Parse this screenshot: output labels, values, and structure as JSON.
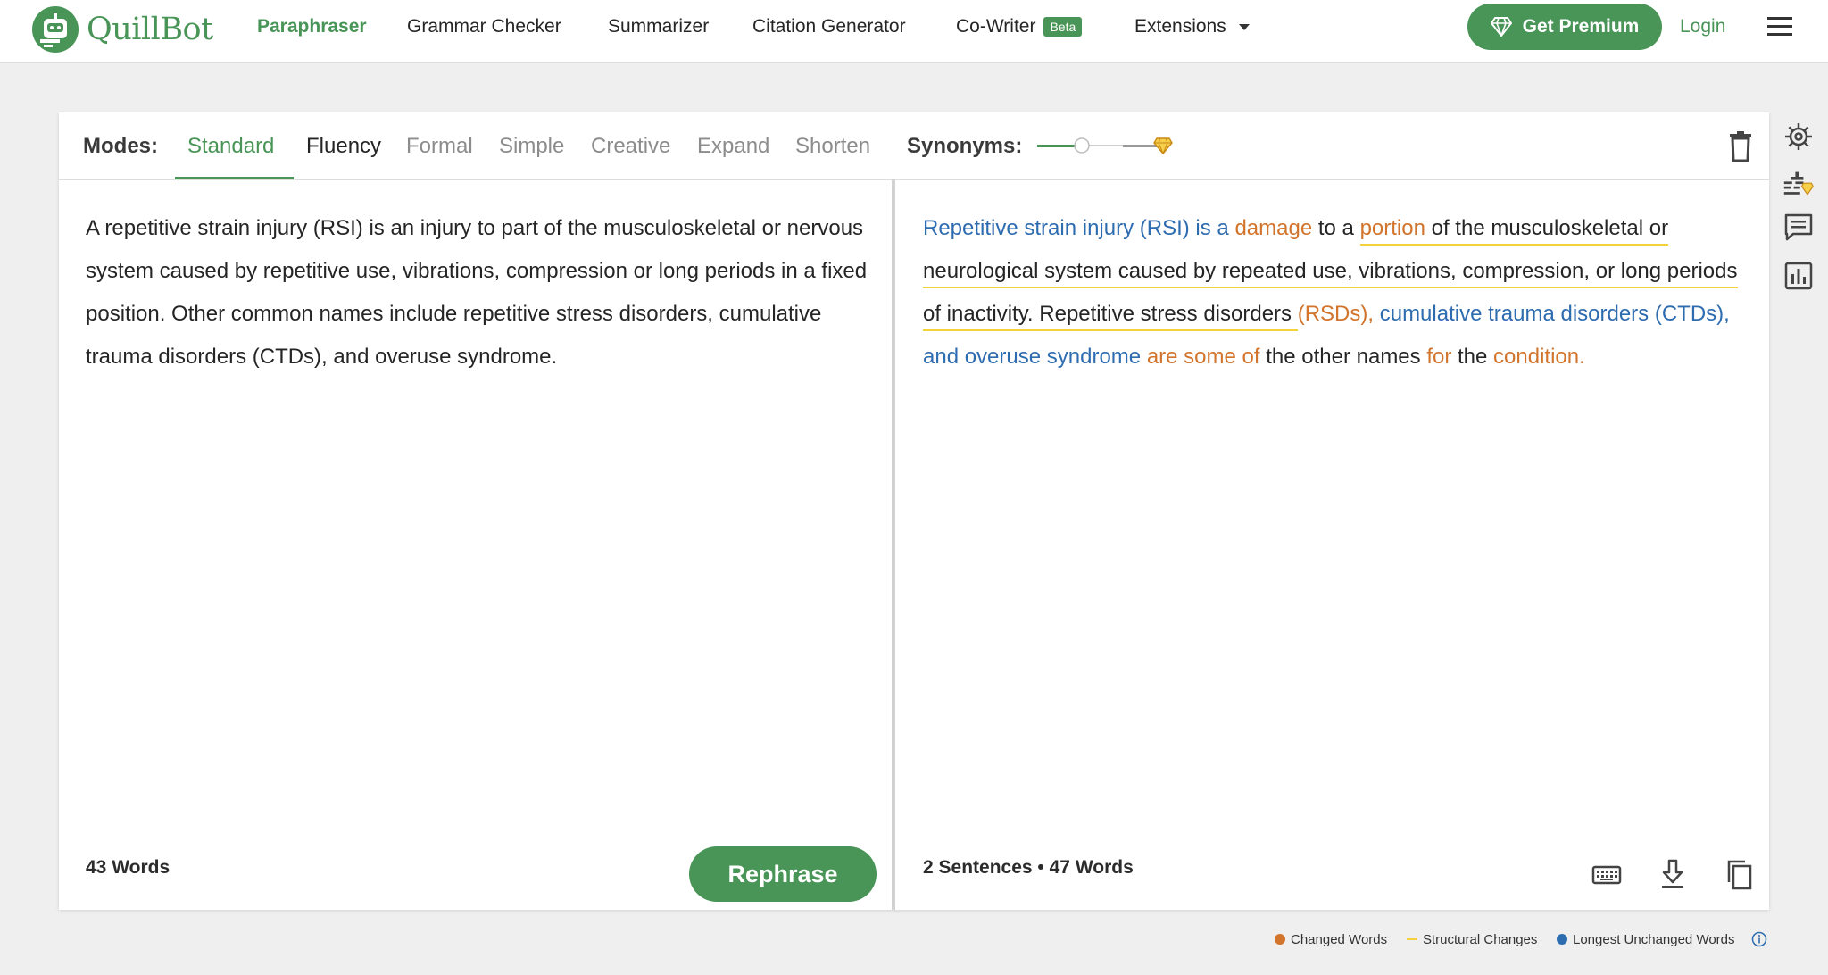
{
  "brand": {
    "name": "QuillBot"
  },
  "nav": {
    "items": [
      "Paraphraser",
      "Grammar Checker",
      "Summarizer",
      "Citation Generator",
      "Co-Writer",
      "Extensions"
    ],
    "beta_badge": "Beta",
    "premium_label": "Get Premium",
    "login_label": "Login"
  },
  "modes": {
    "label": "Modes:",
    "items": [
      "Standard",
      "Fluency",
      "Formal",
      "Simple",
      "Creative",
      "Expand",
      "Shorten"
    ],
    "selected": "Standard"
  },
  "synonyms": {
    "label": "Synonyms:",
    "level": 0.33
  },
  "input": {
    "text": "A repetitive strain injury (RSI) is an injury to part of the musculoskeletal or nervous system caused by repetitive use, vibrations, compression or long periods in a fixed position. Other common names include repetitive stress disorders, cumulative trauma disorders (CTDs), and overuse syndrome.",
    "word_count": "43 Words",
    "rephrase_label": "Rephrase"
  },
  "output": {
    "segments": [
      {
        "t": "Repetitive strain injury (RSI) is a ",
        "k": "unchanged"
      },
      {
        "t": "damage",
        "k": "changed"
      },
      {
        "t": " to a ",
        "k": "plain"
      },
      {
        "t": "portion",
        "k": "changed"
      },
      {
        "t": " of the musculoskeletal or neurological system caused by repeated use, vibrations, compression, or long periods of inactivity. Repetitive stress disorders ",
        "k": "plain"
      },
      {
        "t": "(RSDs), ",
        "k": "changed"
      },
      {
        "t": "cumulative trauma disorders (CTDs), and overuse syndrome ",
        "k": "unchanged"
      },
      {
        "t": "are some of",
        "k": "changed"
      },
      {
        "t": " the other names ",
        "k": "plain"
      },
      {
        "t": "for",
        "k": "changed"
      },
      {
        "t": " the ",
        "k": "plain"
      },
      {
        "t": "condition.",
        "k": "changed"
      }
    ],
    "sentences": "2 Sentences",
    "separator": "•",
    "word_count": "47 Words"
  },
  "legend": {
    "changed": "Changed Words",
    "structural": "Structural Changes",
    "unchanged": "Longest Unchanged Words"
  },
  "colors": {
    "brand": "#499557",
    "changed": "#d2742c",
    "structural": "#f3d23d",
    "unchanged": "#2e6cb0",
    "premium_gem": "#e0a526"
  },
  "icons": {
    "rail": [
      "gear-icon",
      "compare-modes-icon",
      "feedback-icon",
      "statistics-icon"
    ],
    "output_actions": [
      "keyboard-icon",
      "download-icon",
      "copy-icon"
    ]
  }
}
